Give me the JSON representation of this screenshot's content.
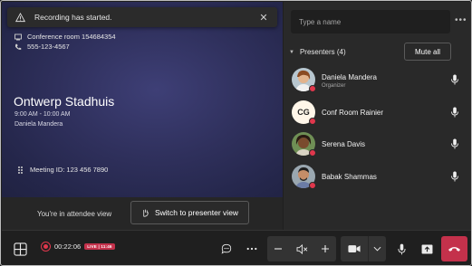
{
  "toast": {
    "message": "Recording has started.",
    "icon": "warning-icon",
    "close": "✕"
  },
  "room": {
    "conference_room": "Conference room 154684354",
    "phone": "555-123-4567"
  },
  "meeting": {
    "title": "Ontwerp Stadhuis",
    "time": "9:00 AM - 10:00 AM",
    "organizer": "Daniela Mandera",
    "meeting_id": "Meeting ID: 123 456 7890"
  },
  "attendee_bar": {
    "text": "You're in attendee view",
    "switch_label": "Switch to presenter view"
  },
  "panel": {
    "search_placeholder": "Type a name",
    "more": "•••",
    "presenters_label": "Presenters (4)",
    "mute_all_label": "Mute all",
    "people": [
      {
        "name": "Daniela Mandera",
        "role": "Organizer",
        "avatar": "photo"
      },
      {
        "name": "Conf Room Rainier",
        "role": "",
        "avatar": "initials",
        "initials": "CG"
      },
      {
        "name": "Serena Davis",
        "role": "",
        "avatar": "photo"
      },
      {
        "name": "Babak Shammas",
        "role": "",
        "avatar": "photo"
      }
    ]
  },
  "toolbar": {
    "recording_time": "00:22:06",
    "live_badge": "LIVE | 11:46"
  },
  "colors": {
    "accent_red": "#c4314b",
    "stage_blue": "#2f305c",
    "panel_bg": "#292929"
  }
}
